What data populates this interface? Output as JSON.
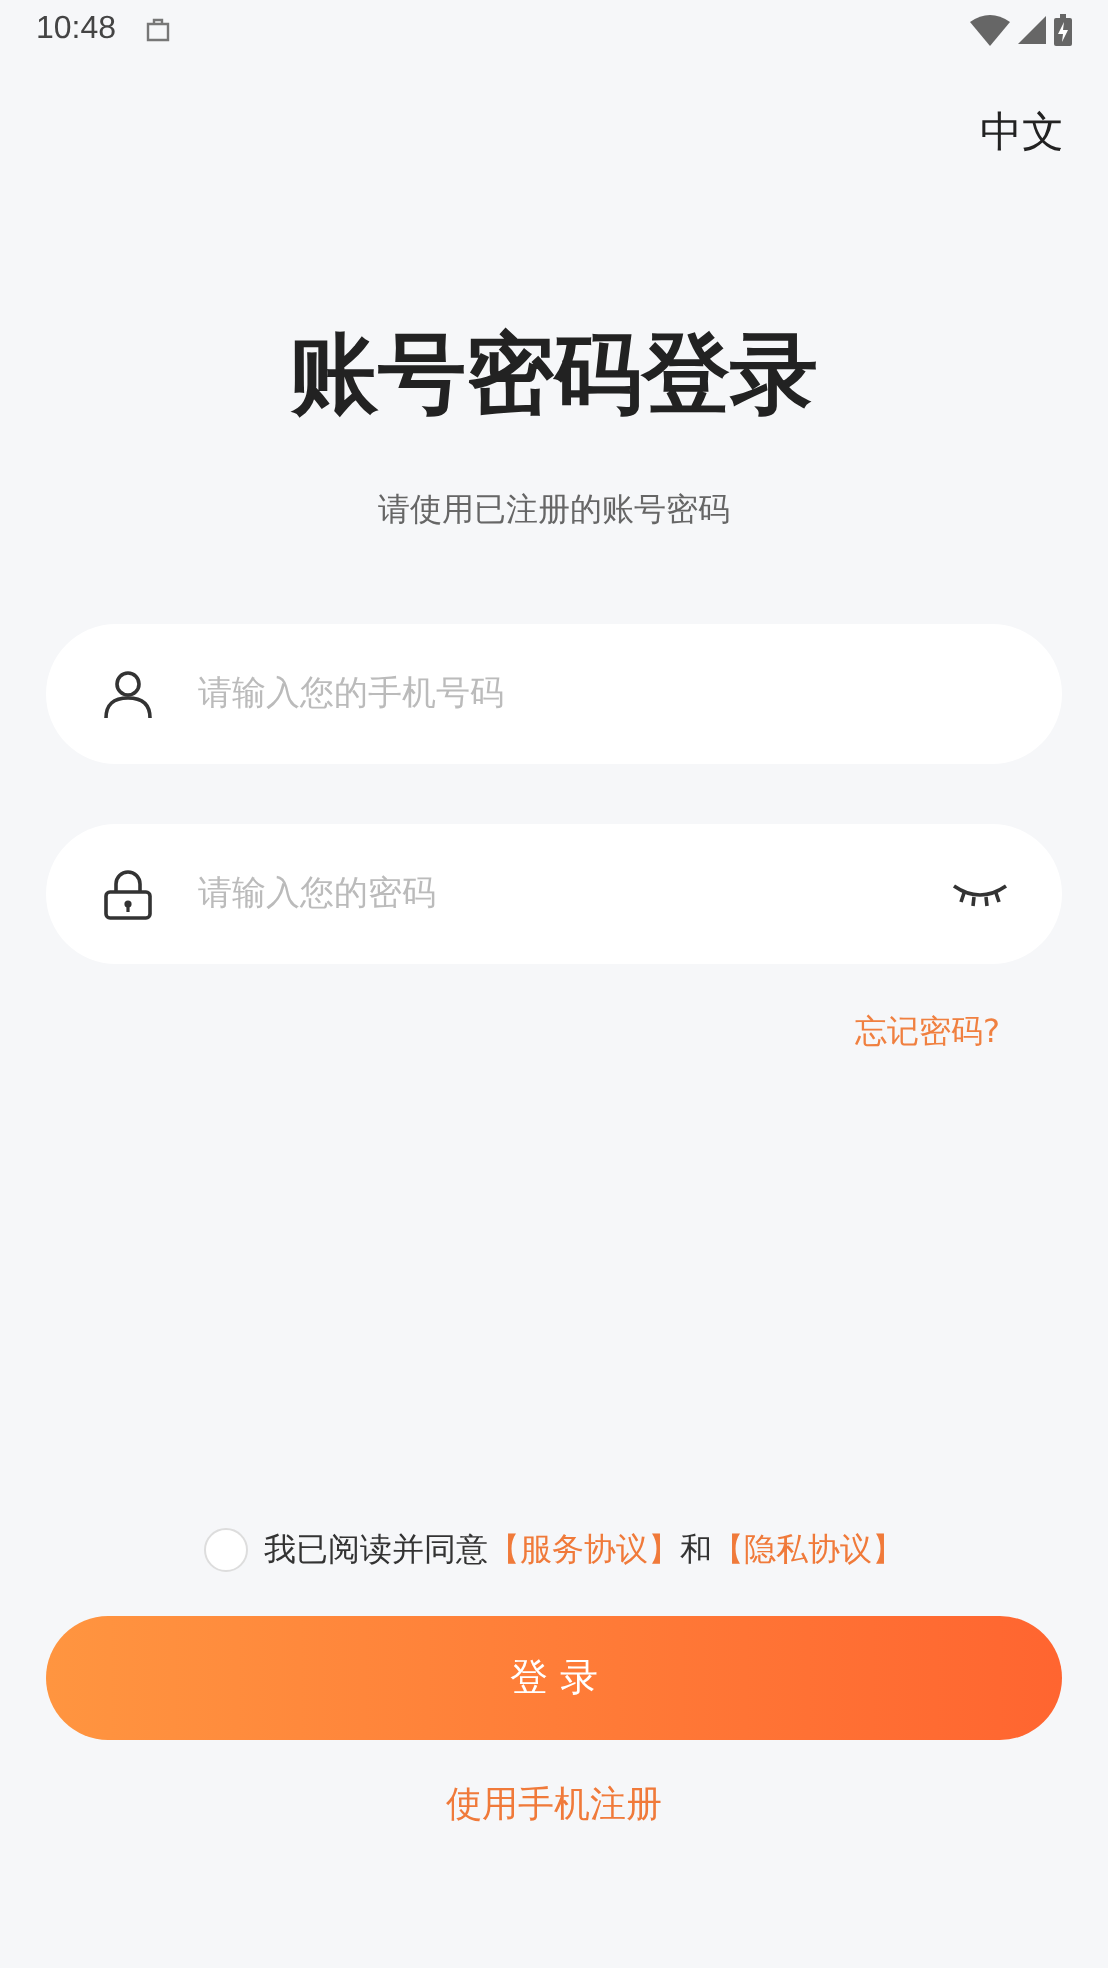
{
  "status_bar": {
    "time": "10:48"
  },
  "language": "中文",
  "title": "账号密码登录",
  "subtitle": "请使用已注册的账号密码",
  "fields": [
    {
      "kind": "phone",
      "placeholder": "请输入您的手机号码"
    },
    {
      "kind": "password",
      "placeholder": "请输入您的密码",
      "password_visible": false
    }
  ],
  "forgot_link": "忘记密码?",
  "agreement": {
    "checked": false,
    "parts": [
      {
        "kind": "text",
        "text": "我已阅读并同意"
      },
      {
        "kind": "link",
        "text": "【服务协议】"
      },
      {
        "kind": "text",
        "text": "和"
      },
      {
        "kind": "link",
        "text": "【隐私协议】"
      }
    ]
  },
  "login_button": "登 录",
  "register_link": "使用手机注册"
}
